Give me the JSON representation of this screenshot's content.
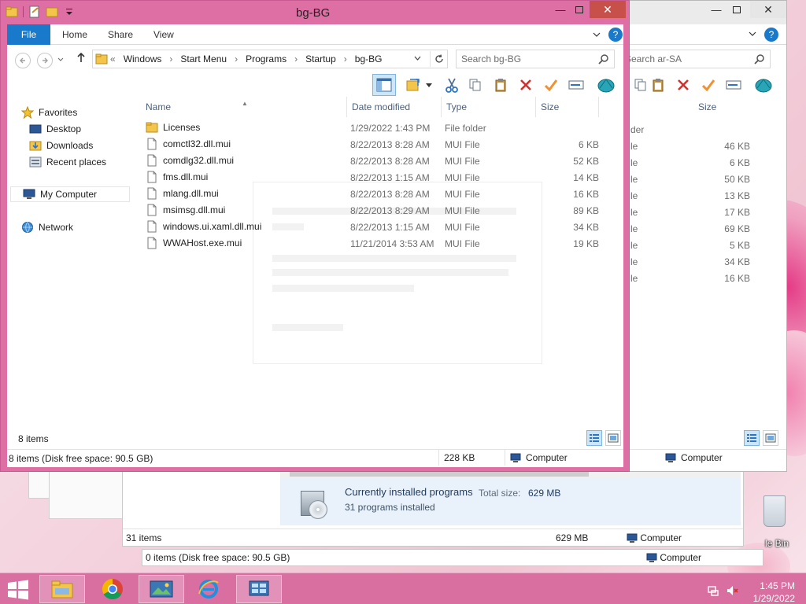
{
  "desktop": {
    "recycle_bin_label": "le Bin"
  },
  "programs_window": {
    "title": "Currently installed programs",
    "total_size_label": "Total size:",
    "total_size": "629 MB",
    "count": "31 programs installed",
    "status_items": "31 items",
    "status_size": "629 MB",
    "status_location": "Computer"
  },
  "bottom_window": {
    "status_items": "0 items (Disk free space: 90.5 GB)",
    "status_location": "Computer"
  },
  "arsa_window": {
    "search_placeholder": "Search ar-SA",
    "size_header": "Size",
    "type_fragment": "der",
    "type_rows": [
      "le",
      "le",
      "le",
      "le",
      "le",
      "le",
      "le",
      "le",
      "le"
    ],
    "sizes": [
      "46 KB",
      "6 KB",
      "50 KB",
      "13 KB",
      "17 KB",
      "69 KB",
      "5 KB",
      "34 KB",
      "16 KB"
    ],
    "status_location": "Computer"
  },
  "main_window": {
    "title": "bg-BG",
    "tabs": {
      "file": "File",
      "home": "Home",
      "share": "Share",
      "view": "View"
    },
    "breadcrumb": {
      "overflow": "«",
      "parts": [
        "Windows",
        "Start Menu",
        "Programs",
        "Startup",
        "bg-BG"
      ]
    },
    "search_placeholder": "Search bg-BG",
    "nav": {
      "favorites": "Favorites",
      "desktop": "Desktop",
      "downloads": "Downloads",
      "recent_places": "Recent places",
      "my_computer": "My Computer",
      "network": "Network"
    },
    "columns": {
      "name": "Name",
      "date": "Date modified",
      "type": "Type",
      "size": "Size"
    },
    "files": [
      {
        "name": "Licenses",
        "date": "1/29/2022 1:43 PM",
        "type": "File folder",
        "size": "",
        "kind": "folder"
      },
      {
        "name": "comctl32.dll.mui",
        "date": "8/22/2013 8:28 AM",
        "type": "MUI File",
        "size": "6 KB",
        "kind": "file"
      },
      {
        "name": "comdlg32.dll.mui",
        "date": "8/22/2013 8:28 AM",
        "type": "MUI File",
        "size": "52 KB",
        "kind": "file"
      },
      {
        "name": "fms.dll.mui",
        "date": "8/22/2013 1:15 AM",
        "type": "MUI File",
        "size": "14 KB",
        "kind": "file"
      },
      {
        "name": "mlang.dll.mui",
        "date": "8/22/2013 8:28 AM",
        "type": "MUI File",
        "size": "16 KB",
        "kind": "file"
      },
      {
        "name": "msimsg.dll.mui",
        "date": "8/22/2013 8:29 AM",
        "type": "MUI File",
        "size": "89 KB",
        "kind": "file"
      },
      {
        "name": "windows.ui.xaml.dll.mui",
        "date": "8/22/2013 1:15 AM",
        "type": "MUI File",
        "size": "34 KB",
        "kind": "file"
      },
      {
        "name": "WWAHost.exe.mui",
        "date": "11/21/2014 3:53 AM",
        "type": "MUI File",
        "size": "19 KB",
        "kind": "file"
      }
    ],
    "item_count": "8 items",
    "status": {
      "items": "8 items (Disk free space: 90.5 GB)",
      "size": "228 KB",
      "location": "Computer"
    }
  },
  "taskbar": {
    "time": "1:45 PM",
    "date": "1/29/2022"
  },
  "colors": {
    "window_frame": "#de6fa5",
    "taskbar": "#d96ea0",
    "file_tab": "#1979ca",
    "close_button": "#c7504b"
  }
}
